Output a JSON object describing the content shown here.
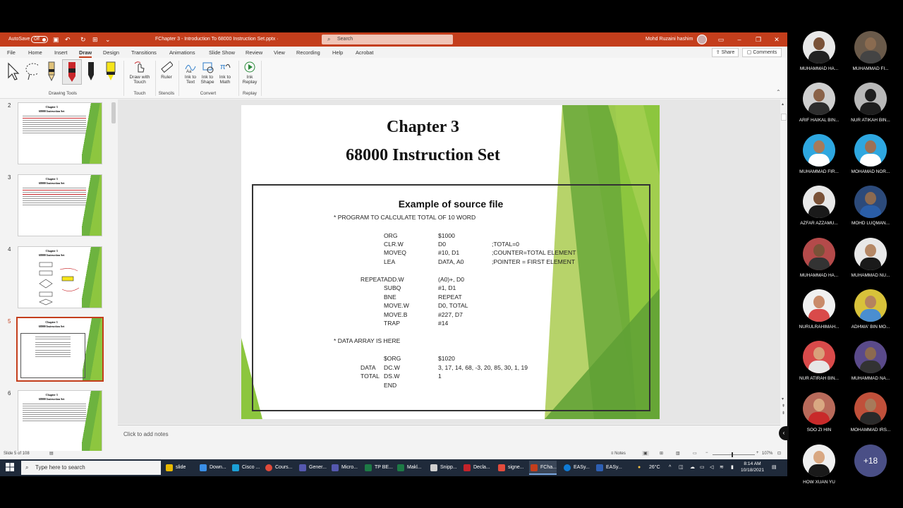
{
  "ppt": {
    "autosave_label": "AutoSave",
    "autosave_state": "Off",
    "file_name": "FChapter 3 - Introduction To 68000 Instruction Set.pptx  ·",
    "search_placeholder": "Search",
    "user_name": "Mohd Ruzaini hashim",
    "menu": [
      "File",
      "Home",
      "Insert",
      "Draw",
      "Design",
      "Transitions",
      "Animations",
      "Slide Show",
      "Review",
      "View",
      "Recording",
      "Help",
      "Acrobat"
    ],
    "share_label": "Share",
    "comments_label": "Comments",
    "ribbon": {
      "draw_with_touch": "Draw with Touch",
      "ruler": "Ruler",
      "ink_to_text": "Ink to Text",
      "ink_to_shape": "Ink to Shape",
      "ink_to_math": "Ink to Math",
      "ink_replay": "Ink Replay",
      "groups": {
        "drawing_tools": "Drawing Tools",
        "touch": "Touch",
        "stencils": "Stencils",
        "convert": "Convert",
        "replay": "Replay"
      }
    },
    "thumbnails": [
      {
        "num": "2",
        "t1": "Chapter 3",
        "t2": "68000 Instruction Set"
      },
      {
        "num": "3",
        "t1": "Chapter 3",
        "t2": "68000 Instruction Set"
      },
      {
        "num": "4",
        "t1": "Chapter 3",
        "t2": "68000 Instruction Set"
      },
      {
        "num": "5",
        "t1": "Chapter 3",
        "t2": "68000 Instruction Set"
      },
      {
        "num": "6",
        "t1": "Chapter 3",
        "t2": "68000 Instruction Set"
      }
    ],
    "slide": {
      "title1": "Chapter 3",
      "title2": "68000 Instruction Set",
      "box_header": "Example of source file",
      "comment1": "* PROGRAM TO CALCULATE TOTAL OF 10 WORD",
      "comment2": "* DATA ARRAY IS HERE",
      "labels": [
        "REPEAT",
        "DATA",
        "TOTAL"
      ],
      "mnemonics": [
        "ORG",
        "CLR.W",
        "MOVEQ",
        "LEA",
        "ADD.W",
        "SUBQ",
        "BNE",
        "MOVE.W",
        "MOVE.B",
        "TRAP",
        "$ORG",
        "DC.W",
        "DS.W",
        "END"
      ],
      "operands": [
        "$1000",
        "D0",
        "#10, D1",
        "DATA, A0",
        "(A0)+, D0",
        "#1, D1",
        "REPEAT",
        "D0, TOTAL",
        "#227, D7",
        "#14",
        "$1020",
        "3, 17, 14, 68, -3, 20, 85, 30, 1, 19",
        "1"
      ],
      "comments": [
        ";TOTAL=0",
        ";COUNTER=TOTAL ELEMENT",
        ";POINTER = FIRST ELEMENT"
      ]
    },
    "notes_placeholder": "Click to add notes",
    "status_slide": "Slide 5 of 108",
    "status_notes": "Notes",
    "zoom": "107%"
  },
  "taskbar": {
    "search_placeholder": "Type here to search",
    "apps": [
      {
        "label": "slide",
        "color": "#e8b900"
      },
      {
        "label": "Down...",
        "color": "#3a8ee6"
      },
      {
        "label": "Cisco ...",
        "color": "#1ba0d7"
      },
      {
        "label": "Cours...",
        "color": "#e04a3a"
      },
      {
        "label": "Gener...",
        "color": "#5558af"
      },
      {
        "label": "Micro...",
        "color": "#5558af"
      },
      {
        "label": "TP BE...",
        "color": "#1d7a45"
      },
      {
        "label": "Makl...",
        "color": "#1d7a45"
      },
      {
        "label": "Snipp...",
        "color": "#d0d0d0"
      },
      {
        "label": "Decla...",
        "color": "#c4232a"
      },
      {
        "label": "signe...",
        "color": "#e24b3c"
      },
      {
        "label": "FCha...",
        "color": "#c43e1c"
      },
      {
        "label": "EASy...",
        "color": "#0f7bd6"
      },
      {
        "label": "EASy...",
        "color": "#2d5fb3"
      }
    ],
    "weather": "26°C",
    "time": "8:14 AM",
    "date": "10/18/2021"
  },
  "participants": [
    {
      "name": "MUHAMMAD HA...",
      "bg": "#e8e8e8",
      "skin": "#7a5238",
      "shirt": "#222222"
    },
    {
      "name": "MUHAMMAD FI...",
      "bg": "#6a5a4a",
      "skin": "#8a6b50",
      "shirt": "#444444"
    },
    {
      "name": "ARIF HAIKAL BIN...",
      "bg": "#cfcfcf",
      "skin": "#8a6248",
      "shirt": "#2d2d2d"
    },
    {
      "name": "NUR ATIKAH BIN...",
      "bg": "#b8b8b8",
      "skin": "#1e1e1e",
      "shirt": "#1e1e1e"
    },
    {
      "name": "MUHAMMAD FIR...",
      "bg": "#2ea7e0",
      "skin": "#a77a5a",
      "shirt": "#ffffff"
    },
    {
      "name": "MOHAMAD NOR...",
      "bg": "#2ea7e0",
      "skin": "#9d7054",
      "shirt": "#ffffff"
    },
    {
      "name": "AZFAR AZZAMU...",
      "bg": "#e8e8e8",
      "skin": "#7a5238",
      "shirt": "#1a1a1a"
    },
    {
      "name": "MOHD LUQMAN...",
      "bg": "#2c4a7a",
      "skin": "#8c6a50",
      "shirt": "#2a5ea8"
    },
    {
      "name": "MUHAMMAD HA...",
      "bg": "#b44a4a",
      "skin": "#7a5238",
      "shirt": "#333333"
    },
    {
      "name": "MUHAMMAD NU...",
      "bg": "#e8e8e8",
      "skin": "#b58866",
      "shirt": "#1a1a1a"
    },
    {
      "name": "NURULRAHIMAH...",
      "bg": "#f0f0f0",
      "skin": "#c98b6a",
      "shirt": "#d94a4a"
    },
    {
      "name": "ADHWA' BIN MO...",
      "bg": "#d8c23a",
      "skin": "#b5835f",
      "shirt": "#4a8ed0"
    },
    {
      "name": "NUR ATIRAH BIN...",
      "bg": "#d94a4a",
      "skin": "#d9a07a",
      "shirt": "#e6e6e6"
    },
    {
      "name": "MUHAMMAD NA...",
      "bg": "#5a4a8a",
      "skin": "#8c6a50",
      "shirt": "#333333"
    },
    {
      "name": "SOO ZI HIN",
      "bg": "#b86a5a",
      "skin": "#d9a882",
      "shirt": "#c82a2a"
    },
    {
      "name": "MOHAMMAD IRS...",
      "bg": "#c0503a",
      "skin": "#a77a5a",
      "shirt": "#2a2a2a"
    },
    {
      "name": "HOW XUAN YU",
      "bg": "#f0f0f0",
      "skin": "#d9a882",
      "shirt": "#1a1a1a"
    }
  ],
  "more_participants": "+18"
}
